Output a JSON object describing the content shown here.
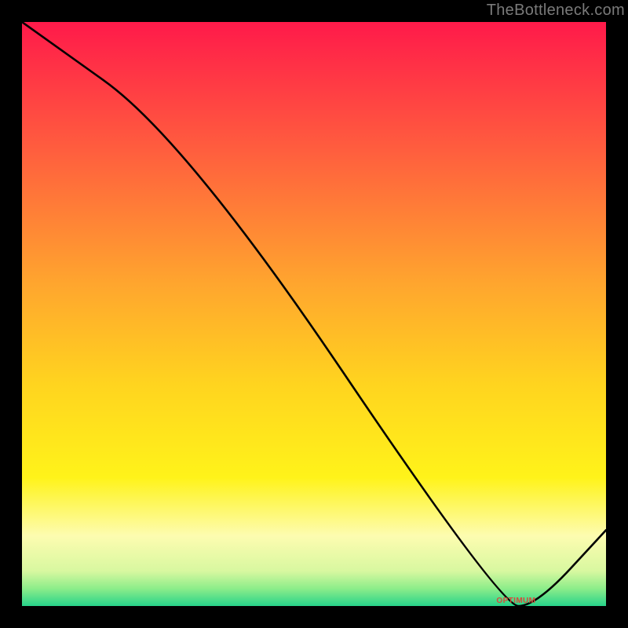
{
  "watermark": "TheBottleneck.com",
  "annotation_label": "OPTIMUM",
  "chart_data": {
    "type": "line",
    "title": "",
    "xlabel": "",
    "ylabel": "",
    "xlim": [
      0,
      100
    ],
    "ylim": [
      0,
      100
    ],
    "x": [
      0,
      28,
      82,
      88,
      100
    ],
    "values": [
      100,
      80,
      0,
      0,
      13
    ],
    "optimum_range_x": [
      82,
      88
    ],
    "background_gradient": [
      {
        "pos": 0.0,
        "color": "#ff1a4a"
      },
      {
        "pos": 0.22,
        "color": "#ff5e3e"
      },
      {
        "pos": 0.45,
        "color": "#ffa62e"
      },
      {
        "pos": 0.62,
        "color": "#ffd41f"
      },
      {
        "pos": 0.78,
        "color": "#fff31a"
      },
      {
        "pos": 0.88,
        "color": "#fdfcb0"
      },
      {
        "pos": 0.94,
        "color": "#d8f8a0"
      },
      {
        "pos": 0.97,
        "color": "#8ded8a"
      },
      {
        "pos": 1.0,
        "color": "#27d38a"
      }
    ]
  }
}
